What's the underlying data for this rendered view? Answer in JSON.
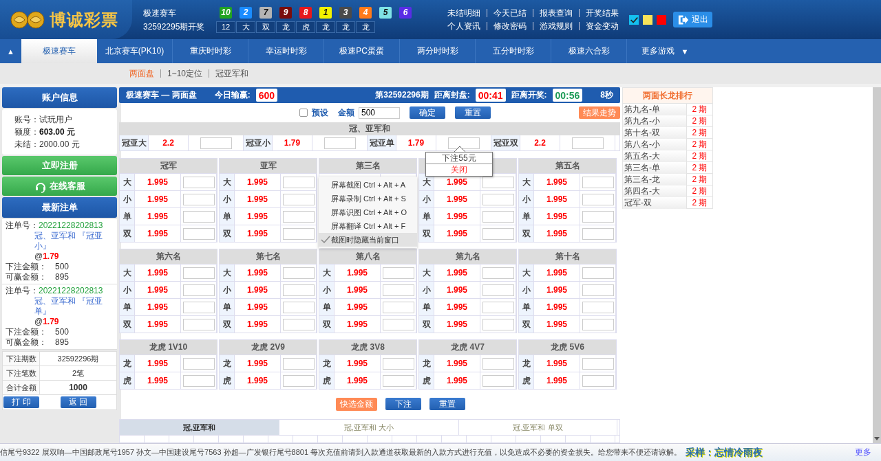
{
  "header": {
    "logo_text": "博诚彩票",
    "game": "极速赛车",
    "draw": "32592295期开奖",
    "balls": [
      {
        "number": "10",
        "color": "#22a322"
      },
      {
        "number": "2",
        "color": "#1a8cff"
      },
      {
        "number": "7",
        "color": "#b4b4b4"
      },
      {
        "number": "9",
        "color": "#7a0c0c"
      },
      {
        "number": "8",
        "color": "#e8181c"
      },
      {
        "number": "1",
        "color": "#f2f200"
      },
      {
        "number": "3",
        "color": "#4a4a4a"
      },
      {
        "number": "4",
        "color": "#ff7a1a"
      },
      {
        "number": "5",
        "color": "#7fe3e6"
      },
      {
        "number": "6",
        "color": "#5a2de6"
      }
    ],
    "results": [
      "12",
      "大",
      "双",
      "龙",
      "虎",
      "龙",
      "龙",
      "龙"
    ],
    "links": [
      "未结明细",
      "今天已结",
      "报表查询",
      "开奖结果",
      "个人资讯",
      "修改密码",
      "游戏规则",
      "资金变动"
    ],
    "themes": [
      {
        "color": "#14c0f0",
        "selected": true
      },
      {
        "color": "#f7e35a",
        "selected": false
      },
      {
        "color": "#ff0000",
        "selected": false
      }
    ],
    "logout": "退出"
  },
  "nav": {
    "toggle": "▲",
    "tabs": [
      {
        "label": "极速赛车",
        "selected": true
      },
      {
        "label": "北京赛车(PK10)",
        "selected": false
      },
      {
        "label": "重庆时时彩",
        "selected": false
      },
      {
        "label": "幸运时时彩",
        "selected": false
      },
      {
        "label": "极速PC蛋蛋",
        "selected": false
      },
      {
        "label": "两分时时彩",
        "selected": false
      },
      {
        "label": "五分时时彩",
        "selected": false
      },
      {
        "label": "极速六合彩",
        "selected": false
      }
    ],
    "more": "更多游戏",
    "more_arrow": "▼"
  },
  "subnav": [
    {
      "label": "两面盘",
      "selected": true
    },
    {
      "label": "1~10定位",
      "selected": false
    },
    {
      "label": "冠亚军和",
      "selected": false
    }
  ],
  "sidebar": {
    "account_title": "账户信息",
    "account": [
      {
        "label": "账号：",
        "value": "试玩用户",
        "bold": false
      },
      {
        "label": "额度：",
        "value": "603.00",
        "unit": " 元",
        "bold": true
      },
      {
        "label": "未结：",
        "value": "2000.00",
        "unit": " 元",
        "bold": false
      }
    ],
    "register": "立即注册",
    "service": "在线客服",
    "latest_title": "最新注单",
    "bets": [
      {
        "label": "注单号：",
        "number": "20221228202813",
        "item": "冠、亚军和 『冠亚小』",
        "at": "@",
        "odds": "1.79",
        "amount_label": "下注金额：",
        "amount": "500",
        "win_label": "可赢金额：",
        "win": "895"
      },
      {
        "label": "注单号：",
        "number": "20221228202813",
        "item": "冠、亚军和 『冠亚单』",
        "at": "@",
        "odds": "1.79",
        "amount_label": "下注金额：",
        "amount": "500",
        "win_label": "可赢金额：",
        "win": "895"
      }
    ],
    "summary": [
      {
        "label": "下注期数",
        "value": "32592296期",
        "bold": false
      },
      {
        "label": "下注笔数",
        "value": "2笔",
        "bold": false
      },
      {
        "label": "合计金额",
        "value": "1000",
        "bold": true
      }
    ],
    "buttons": [
      "打 印",
      "返 回"
    ]
  },
  "bet_panel": {
    "title": "极速赛车 — 两面盘",
    "today_label": "今日输赢:",
    "today": "600",
    "period": "第32592296期",
    "close_label": "距离封盘:",
    "close_time": "00:41",
    "open_label": "距离开奖:",
    "open_time": "00:56",
    "refresh": "8秒",
    "preset": {
      "label": "预设",
      "checked": false
    },
    "amount_label": "金额",
    "amount": "500",
    "confirm": "确定",
    "reset": "重置",
    "trend": "结果走势",
    "sum_title": "冠、亚军和",
    "sum_items": [
      {
        "label": "冠亚大",
        "odds": "2.2"
      },
      {
        "label": "冠亚小",
        "odds": "1.79"
      },
      {
        "label": "冠亚单",
        "odds": "1.79"
      },
      {
        "label": "冠亚双",
        "odds": "2.2"
      }
    ],
    "tooltip": {
      "text": "下注55元",
      "close": "关闭"
    },
    "positions": [
      {
        "title": "冠军",
        "rows": [
          [
            "大",
            "1.995"
          ],
          [
            "小",
            "1.995"
          ],
          [
            "单",
            "1.995"
          ],
          [
            "双",
            "1.995"
          ]
        ]
      },
      {
        "title": "亚军",
        "rows": [
          [
            "大",
            "1.995"
          ],
          [
            "小",
            "1.995"
          ],
          [
            "单",
            "1.995"
          ],
          [
            "双",
            "1.995"
          ]
        ]
      },
      {
        "title": "第三名",
        "rows": [
          [
            null,
            null
          ],
          [
            null,
            null
          ],
          [
            null,
            null
          ],
          [
            null,
            null
          ]
        ]
      },
      {
        "rows": [
          [
            "大",
            "1.995"
          ],
          [
            "小",
            "1.995"
          ],
          [
            "单",
            "1.995"
          ],
          [
            "双",
            "1.995"
          ]
        ]
      },
      {
        "title": "第五名",
        "rows": [
          [
            "大",
            "1.995"
          ],
          [
            "小",
            "1.995"
          ],
          [
            "单",
            "1.995"
          ],
          [
            "双",
            "1.995"
          ]
        ]
      },
      {
        "title": "第六名",
        "rows": [
          [
            "大",
            "1.995"
          ],
          [
            "小",
            "1.995"
          ],
          [
            "单",
            "1.995"
          ],
          [
            "双",
            "1.995"
          ]
        ]
      },
      {
        "title": "第七名",
        "rows": [
          [
            "大",
            "1.995"
          ],
          [
            "小",
            "1.995"
          ],
          [
            "单",
            "1.995"
          ],
          [
            "双",
            "1.995"
          ]
        ]
      },
      {
        "title": "第八名",
        "rows": [
          [
            "大",
            "1.995"
          ],
          [
            "小",
            "1.995"
          ],
          [
            "单",
            "1.995"
          ],
          [
            "双",
            "1.995"
          ]
        ]
      },
      {
        "title": "第九名",
        "rows": [
          [
            "大",
            "1.995"
          ],
          [
            "小",
            "1.995"
          ],
          [
            "单",
            "1.995"
          ],
          [
            "双",
            "1.995"
          ]
        ]
      },
      {
        "title": "第十名",
        "rows": [
          [
            "大",
            "1.995"
          ],
          [
            "小",
            "1.995"
          ],
          [
            "单",
            "1.995"
          ],
          [
            "双",
            "1.995"
          ]
        ]
      },
      {
        "title": "龙虎 1V10",
        "rows": [
          [
            "龙",
            "1.995"
          ],
          [
            "虎",
            "1.995"
          ]
        ]
      },
      {
        "title": "龙虎 2V9",
        "rows": [
          [
            "龙",
            "1.995"
          ],
          [
            "虎",
            "1.995"
          ]
        ]
      },
      {
        "title": "龙虎 3V8",
        "rows": [
          [
            "龙",
            "1.995"
          ],
          [
            "虎",
            "1.995"
          ]
        ]
      },
      {
        "title": "龙虎 4V7",
        "rows": [
          [
            "龙",
            "1.995"
          ],
          [
            "虎",
            "1.995"
          ]
        ]
      },
      {
        "title": "龙虎 5V6",
        "rows": [
          [
            "龙",
            "1.995"
          ],
          [
            "虎",
            "1.995"
          ]
        ]
      }
    ],
    "quick": "快选金额",
    "submit": "下注",
    "reset2": "重置",
    "stats_tabs": [
      {
        "label": "冠,亚军和",
        "selected": true
      },
      {
        "label": "冠,亚军和 大小",
        "selected": false
      },
      {
        "label": "冠,亚军和 单双",
        "selected": false
      }
    ]
  },
  "context_menu": [
    {
      "label": "屏幕截图 Ctrl + Alt + A",
      "checked": false
    },
    {
      "label": "屏幕录制 Ctrl + Alt + S",
      "checked": false
    },
    {
      "label": "屏幕识图 Ctrl + Alt + O",
      "checked": false
    },
    {
      "label": "屏幕翻译 Ctrl + Alt + F",
      "checked": false
    },
    {
      "label": "截图时隐藏当前窗口",
      "checked": true
    }
  ],
  "ranking": {
    "title": "两面长龙排行",
    "items": [
      {
        "name": "第九名-单",
        "value": "2 期"
      },
      {
        "name": "第九名-小",
        "value": "2 期"
      },
      {
        "name": "第十名-双",
        "value": "2 期"
      },
      {
        "name": "第八名-小",
        "value": "2 期"
      },
      {
        "name": "第五名-大",
        "value": "2 期"
      },
      {
        "name": "第三名-单",
        "value": "2 期"
      },
      {
        "name": "第三名-龙",
        "value": "2 期"
      },
      {
        "name": "第四名-大",
        "value": "2 期"
      },
      {
        "name": "冠军-双",
        "value": "2 期"
      }
    ]
  },
  "ticker": {
    "text": "信尾号9322 展双响—中国邮政尾号1957 孙文—中国建设尾号7563 孙超—广发银行尾号8801 每次充值前请到入款通道获取最新的入款方式进行充值，以免造成不必要的资金损失。给您带来不便还请谅解。",
    "signature": "采样：忘情冷雨夜",
    "more": "更多"
  }
}
